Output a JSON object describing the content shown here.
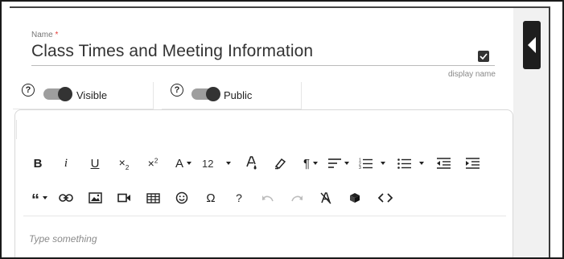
{
  "name_field": {
    "label": "Name",
    "required_marker": "*",
    "value": "Class Times and Meeting Information",
    "display_checkbox_checked": true,
    "hint": "display name"
  },
  "toggles": {
    "visible": {
      "label": "Visible",
      "on": true,
      "help_glyph": "?"
    },
    "public": {
      "label": "Public",
      "on": true,
      "help_glyph": "?"
    }
  },
  "toolbar": {
    "font_size": "12",
    "help_glyph": "?",
    "omega_glyph": "Ω"
  },
  "editor": {
    "placeholder": "Type something"
  },
  "colors": {
    "required": "#e53935",
    "toggle_track": "#9e9e9e",
    "toggle_knob": "#333333",
    "collapse_button": "#1e1e1e",
    "side_panel": "#f1f1f1"
  },
  "icons": [
    "bold-icon",
    "italic-icon",
    "underline-icon",
    "subscript-icon",
    "superscript-icon",
    "font-family-icon",
    "font-size-select",
    "text-color-icon",
    "highlight-icon",
    "paragraph-format-icon",
    "align-icon",
    "ordered-list-icon",
    "unordered-list-icon",
    "outdent-icon",
    "indent-icon",
    "quote-icon",
    "link-icon",
    "image-icon",
    "video-icon",
    "table-icon",
    "emoticon-icon",
    "special-characters-icon",
    "help-icon",
    "undo-icon",
    "redo-icon",
    "clear-formatting-icon",
    "embed-icon",
    "code-view-icon",
    "collapse-panel-icon"
  ]
}
